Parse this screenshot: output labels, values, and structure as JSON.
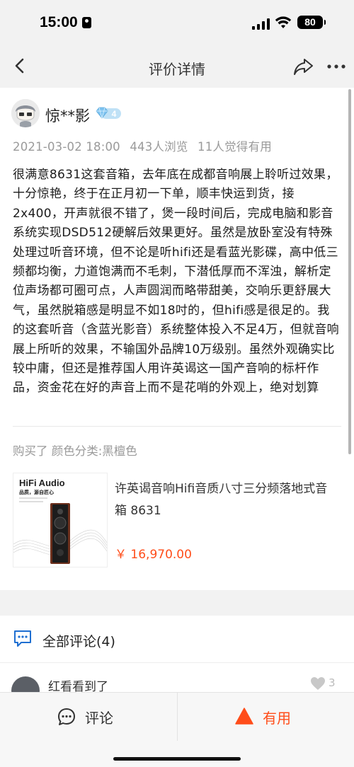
{
  "status_bar": {
    "time": "15:00",
    "battery": "80"
  },
  "nav": {
    "title": "评价详情"
  },
  "review": {
    "username": "惊**影",
    "vip_level": "4",
    "date": "2021-03-02 18:00",
    "views": "443人浏览",
    "helpful": "11人觉得有用",
    "text": "很满意8631这套音箱，去年底在成都音响展上聆听过效果，十分惊艳，终于在正月初一下单，顺丰快运到货，接2x400，开声就很不错了，煲一段时间后，完成电脑和影音系统实现DSD512硬解后效果更好。虽然是放卧室没有特殊处理过听音环境，但不论是听hifi还是看蓝光影碟，高中低三频都均衡，力道饱满而不毛刺，下潜低厚而不浑浊，解析定位声场都可圈可点，人声圆润而略带甜美，交响乐更舒展大气，虽然脱箱感是明显不如18吋的，但hifi感是很足的。我的这套听音（含蓝光影音）系统整体投入不足4万，但就音响展上所听的效果，不输国外品牌10万级别。虽然外观确实比较中庸，但还是推荐国人用许英谒这一国产音响的标杆作品，资金花在好的声音上而不是花哨的外观上，绝对划算",
    "purchase_info": "购买了 颜色分类:黑檀色"
  },
  "product": {
    "image_brand": "HiFi Audio",
    "image_slogan": "品质，源自匠心",
    "name": "许英谒音响Hifi音质八寸三分频落地式音箱 8631",
    "price": "￥ 16,970.00"
  },
  "comments": {
    "header": "全部评论(4)",
    "first": {
      "user": "红看看到了",
      "likes": "3"
    }
  },
  "bottom_bar": {
    "comment_label": "评论",
    "useful_label": "有用"
  },
  "colors": {
    "accent": "#ff4d1a",
    "vip": "#7fc3f0"
  }
}
